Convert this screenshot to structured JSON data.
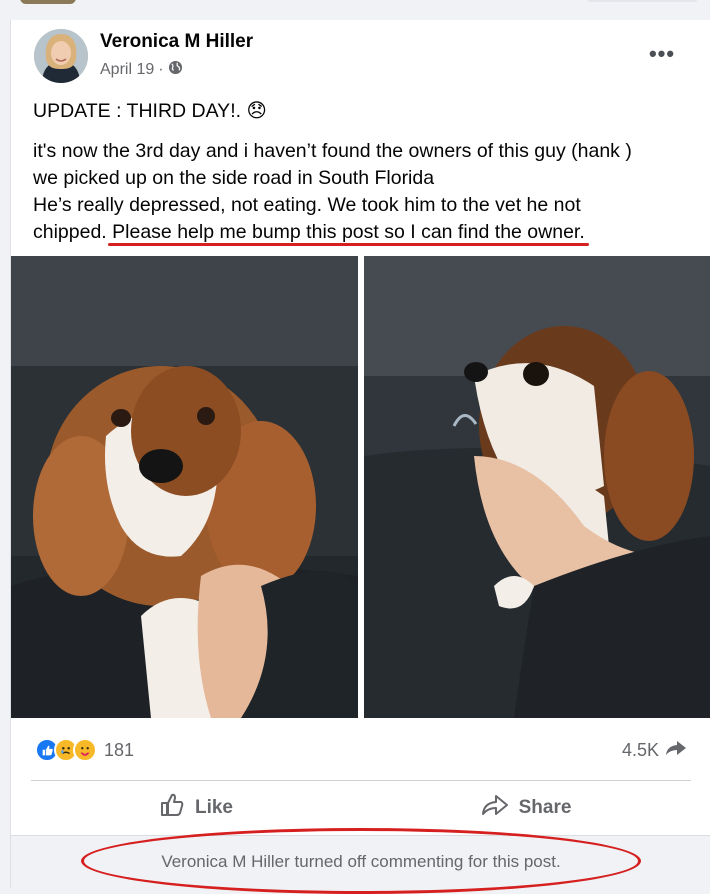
{
  "post": {
    "author": "Veronica M Hiller",
    "date": "April 19",
    "dot": "·",
    "headline": "UPDATE : THIRD DAY!.",
    "headline_emoji": "😞",
    "body_line1": "it's now the 3rd day and i haven’t found the owners of this guy (hank )",
    "body_line2": "we picked up on the side road in  South Florida",
    "body_line3a": "He’s really depressed, not eating. We took him to the vet he not",
    "body_line3b": "chipped.",
    "body_highlight": "Please help me bump this post so I can find the owner."
  },
  "icons": {
    "audience": "globe-icon",
    "more": "more-options-icon",
    "like": "thumbs-up-icon",
    "share": "share-icon"
  },
  "stats": {
    "reactions": [
      "like",
      "care",
      "sad"
    ],
    "reaction_count": "181",
    "shares": "4.5K"
  },
  "actions": {
    "like": "Like",
    "share": "Share"
  },
  "comments_notice": "Veronica M Hiller turned off commenting for this post.",
  "colors": {
    "annotation_red": "#d61f1f",
    "like_blue": "#1877f2",
    "reaction_yellow": "#f7b928",
    "secondary_text": "#65676b"
  }
}
